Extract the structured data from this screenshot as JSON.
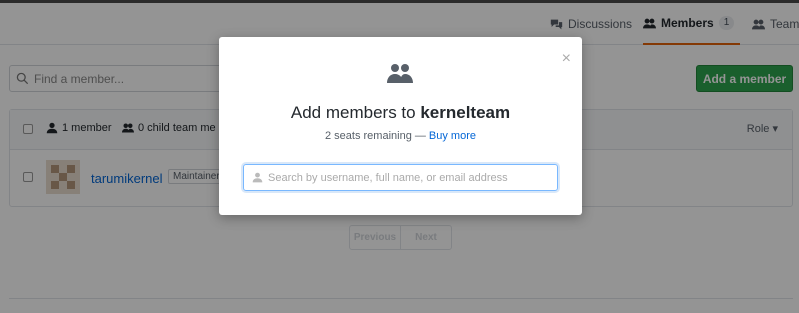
{
  "tabs": [
    {
      "label": "Discussions",
      "icon": "discussion-icon"
    },
    {
      "label": "Members",
      "count": "1",
      "icon": "people-icon"
    },
    {
      "label": "Teams",
      "icon": "people-icon"
    }
  ],
  "toolbar": {
    "find_placeholder": "Find a member...",
    "add_label": "Add a member"
  },
  "list": {
    "member_count": "1 member",
    "child_teams": "0 child team me",
    "role_label": "Role ▾",
    "rows": [
      {
        "username": "tarumikernel",
        "badge": "Maintainer"
      }
    ]
  },
  "pagination": {
    "previous": "Previous",
    "next": "Next"
  },
  "modal": {
    "title_prefix": "Add members to ",
    "team_name": "kernelteam",
    "seats_text": "2 seats remaining — ",
    "buy_more": "Buy more",
    "search_placeholder": "Search by username, full name, or email address",
    "close_symbol": "×"
  },
  "colors": {
    "accent": "#e36209",
    "primary_button": "#2ea44f",
    "link": "#0366d6"
  }
}
